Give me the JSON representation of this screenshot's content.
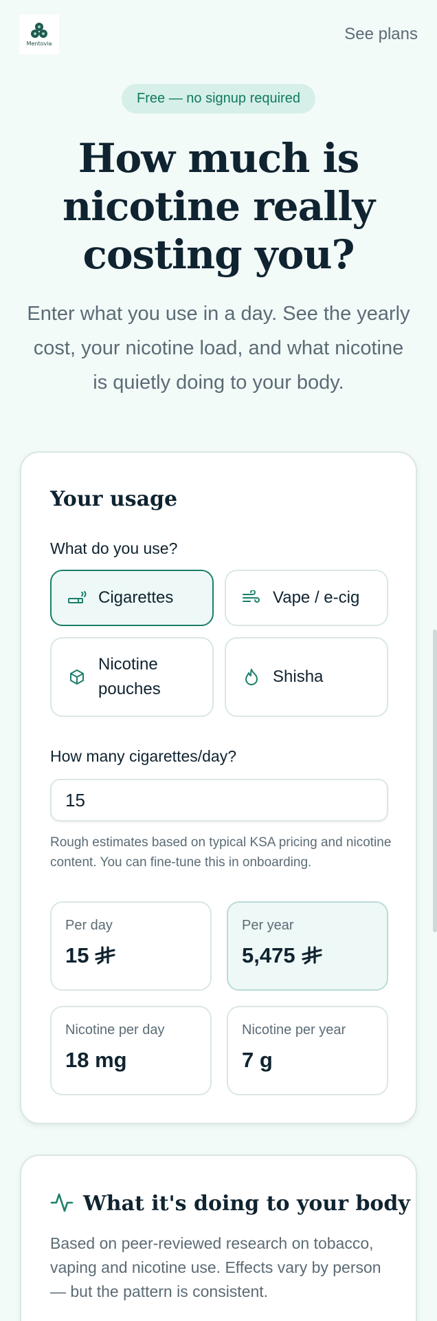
{
  "header": {
    "logo_text": "Mentovia",
    "see_plans": "See plans"
  },
  "hero": {
    "pill": "Free — no signup required",
    "title": "How much is nicotine really costing you?",
    "subtitle": "Enter what you use in a day. See the yearly cost, your nicotine load, and what nicotine is quietly doing to your body."
  },
  "usage": {
    "title": "Your usage",
    "question": "What do you use?",
    "options": [
      {
        "label": "Cigarettes",
        "icon": "cigarette-icon",
        "selected": true
      },
      {
        "label": "Vape / e-cig",
        "icon": "wind-icon",
        "selected": false
      },
      {
        "label": "Nicotine pouches",
        "icon": "box-icon",
        "selected": false
      },
      {
        "label": "Shisha",
        "icon": "flame-icon",
        "selected": false
      }
    ],
    "count_label": "How many cigarettes/day?",
    "count_value": "15",
    "note": "Rough estimates based on typical KSA pricing and nicotine content. You can fine-tune this in onboarding.",
    "stats": [
      {
        "label": "Per day",
        "value": "15",
        "currency": "riyal-icon"
      },
      {
        "label": "Per year",
        "value": "5,475",
        "currency": "riyal-icon"
      },
      {
        "label": "Nicotine per day",
        "value": "18 mg"
      },
      {
        "label": "Nicotine per year",
        "value": "7 g"
      }
    ]
  },
  "body_effects": {
    "icon": "activity-icon",
    "title": "What it's doing to your body",
    "description": "Based on peer-reviewed research on tobacco, vaping and nicotine use. Effects vary by person — but the pattern is consistent."
  },
  "colors": {
    "background": "#f3fbf9",
    "accent": "#1b7f6a",
    "pill_bg": "#d6efe9",
    "text": "#0f2330",
    "muted": "#5b6b75",
    "border": "#d9e7e5"
  }
}
